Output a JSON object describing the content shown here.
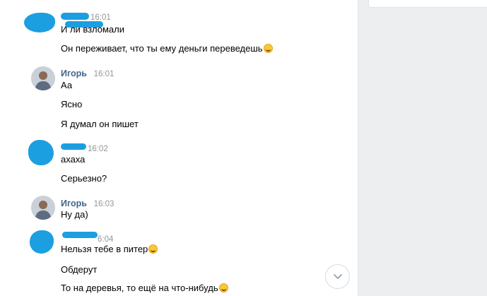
{
  "messages": [
    {
      "author": "",
      "author_redacted": true,
      "time": "16:01",
      "avatar": "redacted",
      "lines": [
        {
          "text": "И     ли  взломали",
          "emoji": false
        },
        {
          "text": "Он переживает, что ты ему деньги переведешь",
          "emoji": true
        }
      ]
    },
    {
      "author": "Игорь",
      "time": "16:01",
      "avatar": "photo",
      "lines": [
        {
          "text": "Аа",
          "emoji": false
        },
        {
          "text": "Ясно",
          "emoji": false
        },
        {
          "text": "Я думал он пишет",
          "emoji": false
        }
      ]
    },
    {
      "author": "",
      "author_redacted": true,
      "time": "16:02",
      "avatar": "redacted",
      "lines": [
        {
          "text": "ахаха",
          "emoji": false
        },
        {
          "text": "Серьезно?",
          "emoji": false
        }
      ]
    },
    {
      "author": "Игорь",
      "time": "16:03",
      "avatar": "photo",
      "lines": [
        {
          "text": "Ну да)",
          "emoji": false
        }
      ]
    },
    {
      "author": "",
      "author_redacted": true,
      "time": "6:04",
      "avatar": "redacted",
      "lines": [
        {
          "text": "Нельзя тебе в питер",
          "emoji": true
        },
        {
          "text": "Обдерут",
          "emoji": false
        },
        {
          "text": "То на деревья, то ещё на что-нибудь",
          "emoji": true
        }
      ]
    }
  ],
  "icons": {
    "scroll_down": "chevron-down-icon",
    "emoji": "grinning-emoji-icon"
  },
  "colors": {
    "author_name": "#42648b",
    "timestamp": "#939699",
    "redaction": "#1b9fe0",
    "sidebar_bg": "#edeef0"
  }
}
